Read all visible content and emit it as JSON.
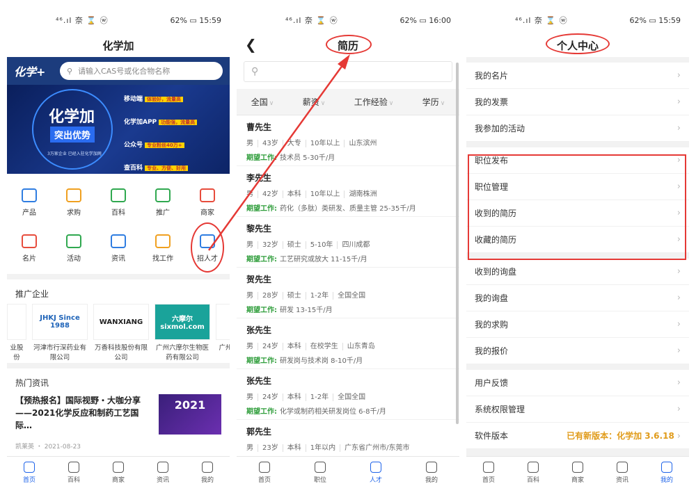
{
  "status": [
    {
      "signal": "⁴⁶.ıl 奈 ⌛ ⓦ",
      "battery": "62% ▭",
      "time": "15:59"
    },
    {
      "signal": "⁴⁶.ıl 奈 ⌛ ⓦ",
      "battery": "62% ▭",
      "time": "16:00"
    },
    {
      "signal": "⁴⁶.ıl 奈 ⌛ ⓦ",
      "battery": "62% ▭",
      "time": "15:59"
    }
  ],
  "home": {
    "title": "化学加",
    "logo": "化学+",
    "logo_sub": "huaxuejia.cn",
    "search_placeholder": "请输入CAS号或化合物名称",
    "banner": {
      "title": "化学加",
      "tag": "突出优势",
      "small": "3万家企业 已经入驻化学加网",
      "features": [
        {
          "name": "移动端",
          "badge": "体验好，流量高"
        },
        {
          "name": "化学加APP",
          "badge": "功能强，流量高"
        },
        {
          "name": "公众号",
          "badge": "专业粉丝40万+"
        },
        {
          "name": "查百科",
          "badge": "专业、方便、好用"
        }
      ]
    },
    "grid": [
      {
        "label": "产品",
        "icon": "store-icon",
        "color": "#2f7de1"
      },
      {
        "label": "求购",
        "icon": "edit-icon",
        "color": "#f0a020"
      },
      {
        "label": "百科",
        "icon": "book-icon",
        "color": "#2fa84f"
      },
      {
        "label": "推广",
        "icon": "crown-icon",
        "color": "#2fa84f"
      },
      {
        "label": "商家",
        "icon": "shop-icon",
        "color": "#e74c3c"
      },
      {
        "label": "名片",
        "icon": "card-icon",
        "color": "#e74c3c"
      },
      {
        "label": "活动",
        "icon": "megaphone-icon",
        "color": "#2fa84f"
      },
      {
        "label": "资讯",
        "icon": "news-icon",
        "color": "#2f7de1"
      },
      {
        "label": "找工作",
        "icon": "briefcase-icon",
        "color": "#f0a020"
      },
      {
        "label": "招人才",
        "icon": "tie-icon",
        "color": "#2f7de1"
      }
    ],
    "promo_title": "推广企业",
    "companies": [
      {
        "logo": "",
        "name": "业股份"
      },
      {
        "logo": "JHKJ Since 1988",
        "name": "河津市行深药业有限公司"
      },
      {
        "logo": "WANXIANG",
        "name": "万香科技股份有限公司"
      },
      {
        "logo": "六摩尔 sixmol.com",
        "name": "广州六摩尔生物医药有限公司"
      },
      {
        "logo": "",
        "name": "广州"
      }
    ],
    "news_title": "热门资讯",
    "news": {
      "headline": "【预热报名】国际视野・大咖分享——2021化学反应和制药工艺国际…",
      "meta": "凯莱英 ・ 2021-08-23",
      "img_text": "2021"
    }
  },
  "resume": {
    "title": "简历",
    "filters": [
      "全国",
      "薪资",
      "工作经验",
      "学历"
    ],
    "label": "期望工作:",
    "list": [
      {
        "name": "曹先生",
        "info": [
          "男",
          "43岁",
          "大专",
          "10年以上",
          "山东滨州"
        ],
        "expect": "技术员  5-30千/月"
      },
      {
        "name": "李先生",
        "info": [
          "男",
          "42岁",
          "本科",
          "10年以上",
          "湖南株洲"
        ],
        "expect": "药化（多肽）类研发、质量主管  25-35千/月"
      },
      {
        "name": "黎先生",
        "info": [
          "男",
          "32岁",
          "硕士",
          "5-10年",
          "四川成都"
        ],
        "expect": "工艺研究或放大  11-15千/月"
      },
      {
        "name": "贺先生",
        "info": [
          "男",
          "28岁",
          "硕士",
          "1-2年",
          "全国全国"
        ],
        "expect": "研发  13-15千/月"
      },
      {
        "name": "张先生",
        "info": [
          "男",
          "24岁",
          "本科",
          "在校学生",
          "山东青岛"
        ],
        "expect": "研发岗与技术岗  8-10千/月"
      },
      {
        "name": "张先生",
        "info": [
          "男",
          "24岁",
          "本科",
          "1-2年",
          "全国全国"
        ],
        "expect": "化学或制药相关研发岗位  6-8千/月"
      },
      {
        "name": "郭先生",
        "info": [
          "男",
          "23岁",
          "本科",
          "1年以内",
          "广东省广州市/东莞市"
        ],
        "expect": "待定  5-7千/月"
      }
    ]
  },
  "profile": {
    "title": "个人中心",
    "groups": [
      [
        {
          "label": "我的名片"
        },
        {
          "label": "我的发票"
        },
        {
          "label": "我参加的活动"
        }
      ],
      [
        {
          "label": "职位发布"
        },
        {
          "label": "职位管理"
        },
        {
          "label": "收到的简历"
        },
        {
          "label": "收藏的简历"
        }
      ],
      [
        {
          "label": "收到的询盘"
        },
        {
          "label": "我的询盘"
        },
        {
          "label": "我的求购"
        },
        {
          "label": "我的报价"
        }
      ],
      [
        {
          "label": "用户反馈"
        },
        {
          "label": "系统权限管理"
        },
        {
          "label": "软件版本",
          "note": "已有新版本：化学加 3.6.18"
        }
      ]
    ]
  },
  "tabbars": [
    {
      "active": 0,
      "tabs": [
        {
          "label": "首页",
          "icon": "home-icon"
        },
        {
          "label": "百科",
          "icon": "book-search-icon"
        },
        {
          "label": "商家",
          "icon": "shop-icon"
        },
        {
          "label": "资讯",
          "icon": "news-icon"
        },
        {
          "label": "我的",
          "icon": "user-icon"
        }
      ]
    },
    {
      "active": 2,
      "tabs": [
        {
          "label": "首页",
          "icon": "home-icon"
        },
        {
          "label": "职位",
          "icon": "briefcase-icon"
        },
        {
          "label": "人才",
          "icon": "graduation-cap-icon"
        },
        {
          "label": "我的",
          "icon": "user-icon"
        }
      ]
    },
    {
      "active": 4,
      "tabs": [
        {
          "label": "首页",
          "icon": "home-icon"
        },
        {
          "label": "百科",
          "icon": "book-search-icon"
        },
        {
          "label": "商家",
          "icon": "shop-icon"
        },
        {
          "label": "资讯",
          "icon": "news-icon"
        },
        {
          "label": "我的",
          "icon": "user-icon"
        }
      ]
    }
  ],
  "colors": {
    "accent": "#1e63e9",
    "annotation": "#e53935",
    "expect_label": "#2e9d3a",
    "version_note": "#e09b1a"
  }
}
